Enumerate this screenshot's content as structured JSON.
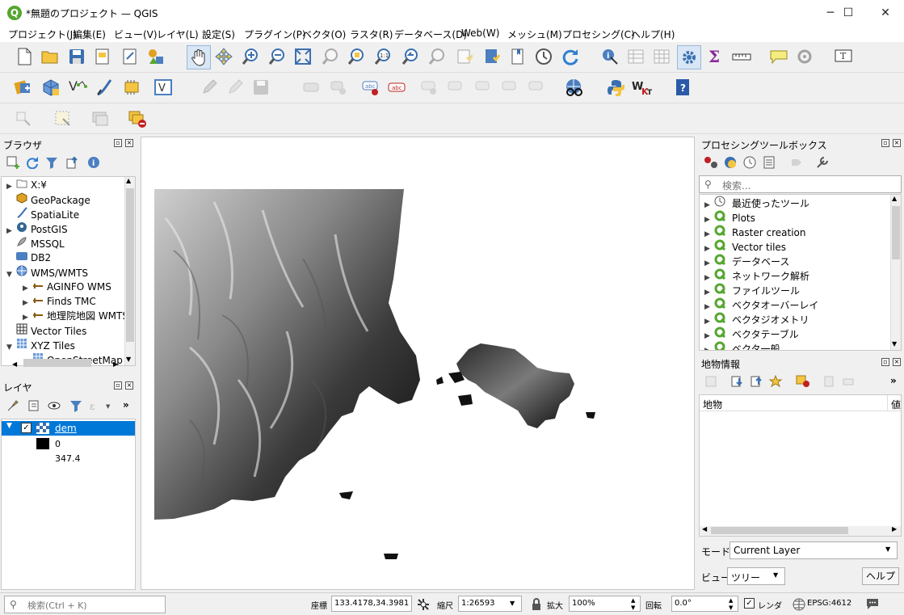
{
  "window": {
    "title": "*無題のプロジェクト — QGIS",
    "minimize": "─",
    "maximize": "☐",
    "close": "✕"
  },
  "menu": [
    "プロジェクト(J)",
    "編集(E)",
    "ビュー(V)",
    "レイヤ(L)",
    "設定(S)",
    "プラグイン(P)",
    "ベクタ(O)",
    "ラスタ(R)",
    "データベース(D)",
    "Web(W)",
    "メッシュ(M)",
    "プロセシング(C)",
    "ヘルプ(H)"
  ],
  "browser": {
    "title": "ブラウザ",
    "items": [
      {
        "label": "X:¥",
        "icon": "folder-icon"
      },
      {
        "label": "GeoPackage",
        "icon": "geopackage-icon"
      },
      {
        "label": "SpatiaLite",
        "icon": "spatialite-icon"
      },
      {
        "label": "PostGIS",
        "icon": "postgis-icon"
      },
      {
        "label": "MSSQL",
        "icon": "mssql-icon"
      },
      {
        "label": "DB2",
        "icon": "db2-icon"
      },
      {
        "label": "WMS/WMTS",
        "icon": "wms-icon"
      },
      {
        "label": "AGINFO WMS",
        "icon": "wms-connection-icon"
      },
      {
        "label": "Finds TMC",
        "icon": "wms-connection-icon"
      },
      {
        "label": "地理院地図 WMTS",
        "icon": "wms-connection-icon"
      },
      {
        "label": "Vector Tiles",
        "icon": "vector-tiles-icon"
      },
      {
        "label": "XYZ Tiles",
        "icon": "xyz-tiles-icon"
      },
      {
        "label": "OpenStreetMap",
        "icon": "xyz-tiles-icon"
      }
    ]
  },
  "layers": {
    "title": "レイヤ",
    "layer_name": "dem",
    "legend_min": "0",
    "legend_max": "347.4"
  },
  "processing": {
    "title": "プロセシングツールボックス",
    "search_placeholder": "検索...",
    "items": [
      "最近使ったツール",
      "Plots",
      "Raster creation",
      "Vector tiles",
      "データベース",
      "ネットワーク解析",
      "ファイルツール",
      "ベクタオーバーレイ",
      "ベクタジオメトリ",
      "ベクタテーブル",
      "ベクタ一般"
    ]
  },
  "identify": {
    "title": "地物情報",
    "col_feature": "地物",
    "col_value": "値",
    "mode_label": "モード",
    "mode_value": "Current Layer",
    "view_label": "ビュー",
    "view_value": "ツリー",
    "help_button": "ヘルプ"
  },
  "status": {
    "search_placeholder": "検索(Ctrl + K)",
    "coord_label": "座標",
    "coord_value": "133.4178,34.3981",
    "scale_label": "縮尺",
    "scale_value": "1:26593",
    "magnifier_label": "拡大",
    "magnifier_value": "100%",
    "rotation_label": "回転",
    "rotation_value": "0.0°",
    "render_label": "レンダ",
    "crs": "EPSG:4612"
  },
  "colors": {
    "accent": "#0078d7",
    "qgis_green": "#55a630",
    "selection": "#0078d7"
  }
}
